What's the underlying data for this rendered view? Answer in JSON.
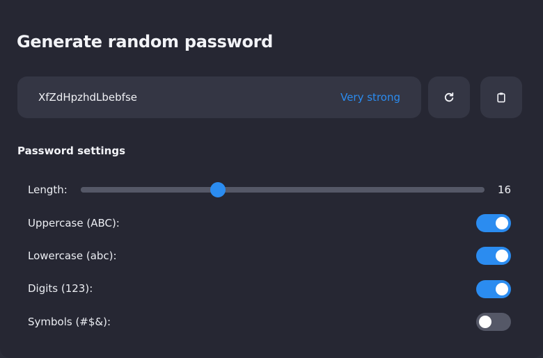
{
  "header": {
    "title": "Generate random password"
  },
  "password": {
    "value": "XfZdHpzhdLbebfse",
    "strength": "Very strong",
    "strength_color": "#2b8cf0"
  },
  "actions": {
    "refresh_icon": "refresh-icon",
    "copy_icon": "clipboard-icon"
  },
  "settings": {
    "title": "Password settings",
    "length": {
      "label": "Length:",
      "value": "16",
      "fraction": 0.339
    },
    "options": [
      {
        "label": "Uppercase (ABC):",
        "enabled": true
      },
      {
        "label": "Lowercase (abc):",
        "enabled": true
      },
      {
        "label": "Digits (123):",
        "enabled": true
      },
      {
        "label": "Symbols (#$&):",
        "enabled": false
      }
    ]
  },
  "colors": {
    "accent": "#2b8cf0",
    "background": "#262733",
    "surface": "#343644",
    "toggle_off": "#555867"
  }
}
